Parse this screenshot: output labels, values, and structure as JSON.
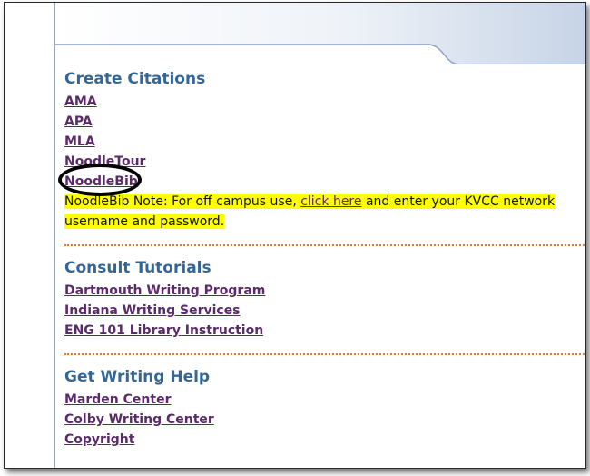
{
  "create": {
    "title": "Create Citations",
    "links": [
      "AMA",
      "APA",
      "MLA",
      "NoodleTour",
      "NoodleBib"
    ],
    "note_prefix": "NoodleBib Note: For off campus use, ",
    "note_link": "click here",
    "note_suffix": " and enter your KVCC network username and password."
  },
  "tutorials": {
    "title": "Consult Tutorials",
    "links": [
      "Dartmouth Writing Program",
      "Indiana Writing Services",
      "ENG 101 Library Instruction"
    ]
  },
  "help": {
    "title": "Get Writing Help",
    "links": [
      "Marden Center",
      "Colby Writing Center",
      "Copyright"
    ]
  },
  "colors": {
    "title": "#336699",
    "link": "#5a2a6a",
    "highlight": "#ffff00",
    "divider": "#e07a2a"
  }
}
